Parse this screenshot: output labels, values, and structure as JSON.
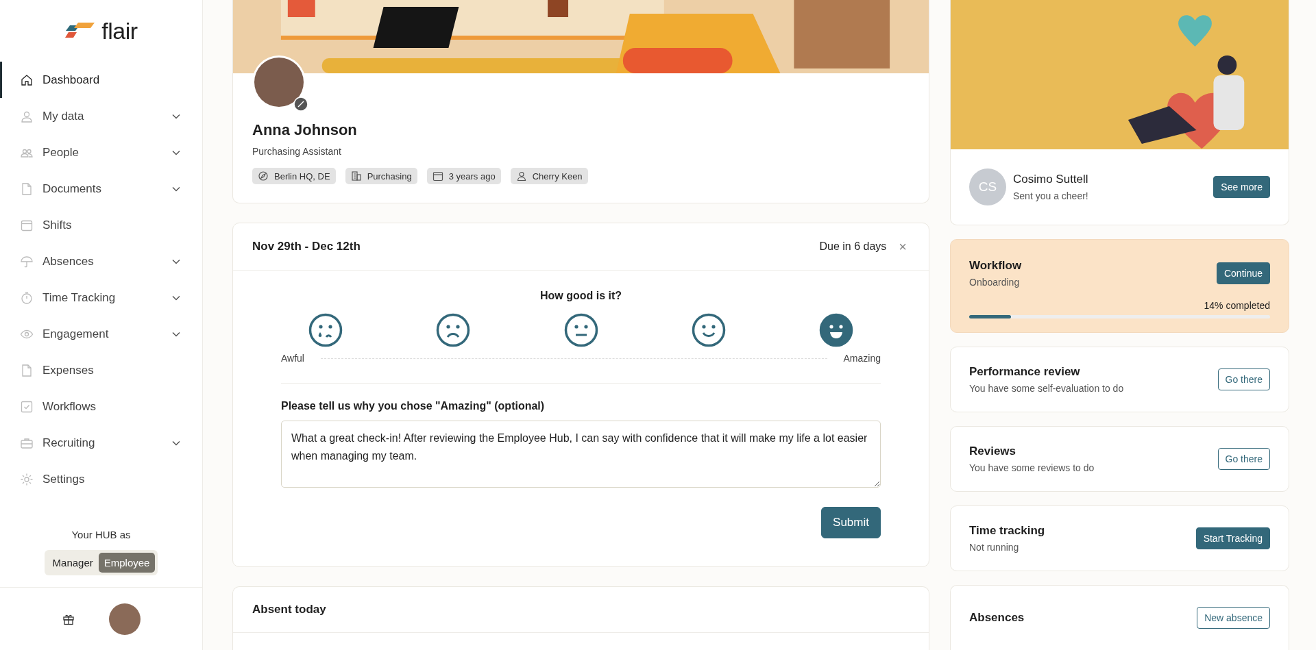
{
  "sidebar": {
    "logo": "flair",
    "items": [
      {
        "label": "Dashboard",
        "kind": "home",
        "selected": true,
        "has_submenu": false
      },
      {
        "label": "My data",
        "kind": "user",
        "selected": false,
        "has_submenu": true
      },
      {
        "label": "People",
        "kind": "users",
        "selected": false,
        "has_submenu": true
      },
      {
        "label": "Documents",
        "kind": "file",
        "selected": false,
        "has_submenu": true
      },
      {
        "label": "Shifts",
        "kind": "calendar",
        "selected": false,
        "has_submenu": false
      },
      {
        "label": "Absences",
        "kind": "umbrella",
        "selected": false,
        "has_submenu": true
      },
      {
        "label": "Time Tracking",
        "kind": "stopwatch",
        "selected": false,
        "has_submenu": true
      },
      {
        "label": "Engagement",
        "kind": "eye",
        "selected": false,
        "has_submenu": true
      },
      {
        "label": "Expenses",
        "kind": "file",
        "selected": false,
        "has_submenu": false
      },
      {
        "label": "Workflows",
        "kind": "check",
        "selected": false,
        "has_submenu": false
      },
      {
        "label": "Recruiting",
        "kind": "briefcase",
        "selected": false,
        "has_submenu": true
      },
      {
        "label": "Settings",
        "kind": "gear",
        "selected": false,
        "has_submenu": false
      }
    ],
    "role_label": "Your HUB as",
    "roles": [
      {
        "label": "Manager",
        "selected": false
      },
      {
        "label": "Employee",
        "selected": true
      }
    ]
  },
  "profile": {
    "name": "Anna Johnson",
    "job_title": "Purchasing Assistant",
    "chips": [
      {
        "kind": "location",
        "label": "Berlin HQ, DE"
      },
      {
        "kind": "department",
        "label": "Purchasing"
      },
      {
        "kind": "date",
        "label": "3 years ago"
      },
      {
        "kind": "manager",
        "label": "Cherry Keen"
      }
    ]
  },
  "checkin": {
    "period": "Nov 29th - Dec 12th",
    "due": "Due in 6 days",
    "close": "×",
    "question": "How good is it?",
    "ratings": [
      {
        "kind": "crying",
        "selected": false
      },
      {
        "kind": "sad",
        "selected": false
      },
      {
        "kind": "neutral",
        "selected": false
      },
      {
        "kind": "smile",
        "selected": false
      },
      {
        "kind": "grin",
        "selected": true
      }
    ],
    "scale_min": "Awful",
    "scale_max": "Amazing",
    "reason_label": "Please tell us why you chose \"Amazing\" (optional)",
    "reason_value": "What a great check-in! After reviewing the Employee Hub, I can say with confidence that it will make my life a lot easier when managing my team.",
    "submit": "Submit"
  },
  "absent_today": {
    "title": "Absent today"
  },
  "cheer": {
    "initials": "CS",
    "name": "Cosimo Suttell",
    "message": "Sent you a cheer!",
    "button": "See more"
  },
  "workflow": {
    "title": "Workflow",
    "subtitle": "Onboarding",
    "button": "Continue",
    "progress_text": "14% completed",
    "level": 0.14
  },
  "tasks": [
    {
      "title": "Performance review",
      "subtitle": "You have some self-evaluation to do",
      "button": "Go there",
      "kind": "outline"
    },
    {
      "title": "Reviews",
      "subtitle": "You have some reviews to do",
      "button": "Go there",
      "kind": "outline"
    },
    {
      "title": "Time tracking",
      "subtitle": "Not running",
      "button": "Start Tracking",
      "kind": "solid"
    },
    {
      "title": "Absences",
      "button": "New absence",
      "kind": "outline"
    }
  ]
}
